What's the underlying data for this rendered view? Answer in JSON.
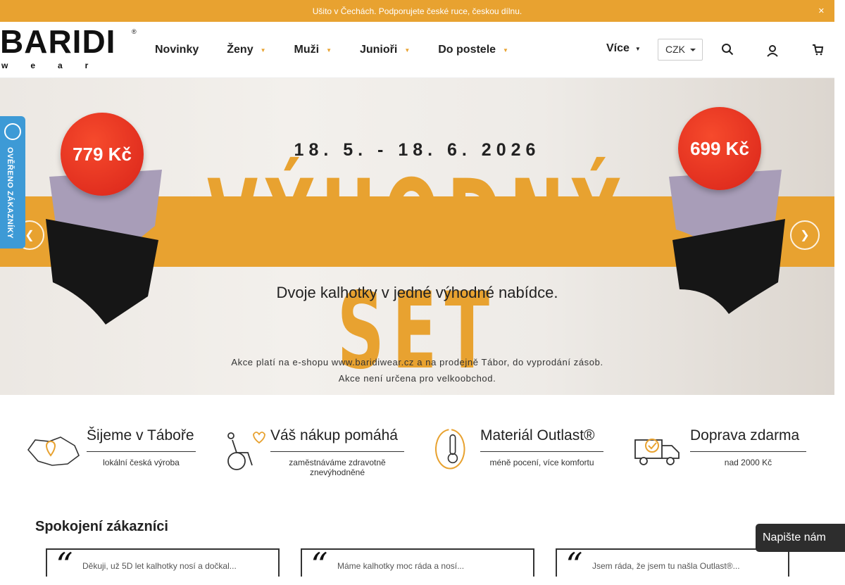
{
  "topbar": {
    "message": "Ušito v Čechách. Podporujete české ruce, českou dílnu.",
    "close_icon": "close-icon"
  },
  "header": {
    "logo_text": "BARIDI",
    "logo_sub": "wear",
    "logo_reg": "®",
    "nav": [
      {
        "label": "Novinky",
        "has_caret": false
      },
      {
        "label": "Ženy",
        "has_caret": true
      },
      {
        "label": "Muži",
        "has_caret": true
      },
      {
        "label": "Junioři",
        "has_caret": true
      },
      {
        "label": "Do postele",
        "has_caret": true
      }
    ],
    "more_label": "Více",
    "currency": "CZK",
    "icons": [
      "search-icon",
      "user-icon",
      "cart-icon"
    ]
  },
  "hero": {
    "date_range": "18. 5. - 18. 6. 2026",
    "headline": "VÝHODNÝ SET",
    "subtitle": "Dvoje kalhotky v jedné výhodné nabídce.",
    "note_line1": "Akce platí na e-shopu www.baridiwear.cz a na prodejně Tábor, do vyprodání zásob.",
    "note_line2": "Akce není určena pro velkoobchod.",
    "price_left": "779 Kč",
    "price_right": "699 Kč",
    "prev_icon": "chevron-left-icon",
    "next_icon": "chevron-right-icon"
  },
  "verified_badge": {
    "label": "OVĚŘENO ZÁKAZNÍKY"
  },
  "features": [
    {
      "title": "Šijeme v Táboře",
      "sub": "lokální česká výroba",
      "icon": "map-pin-icon"
    },
    {
      "title": "Váš nákup pomáhá",
      "sub": "zaměstnáváme zdravotně znevýhodněné",
      "icon": "wheelchair-heart-icon"
    },
    {
      "title": "Materiál Outlast®",
      "sub": "méně pocení, více komfortu",
      "icon": "thermometer-icon"
    },
    {
      "title": "Doprava zdarma",
      "sub": "nad 2000 Kč",
      "icon": "delivery-truck-icon"
    }
  ],
  "reviews": {
    "title": "Spokojení zákazníci",
    "items": [
      {
        "text": "Děkuji, už 5D let kalhotky nosí a dočkal..."
      },
      {
        "text": "Máme kalhotky moc ráda a nosí..."
      },
      {
        "text": "Jsem ráda, že jsem tu našla Outlast®..."
      }
    ]
  },
  "chat": {
    "label": "Napište nám"
  },
  "colors": {
    "accent": "#e8a230",
    "badge": "#3d9ad6",
    "price": "#e22f20"
  }
}
